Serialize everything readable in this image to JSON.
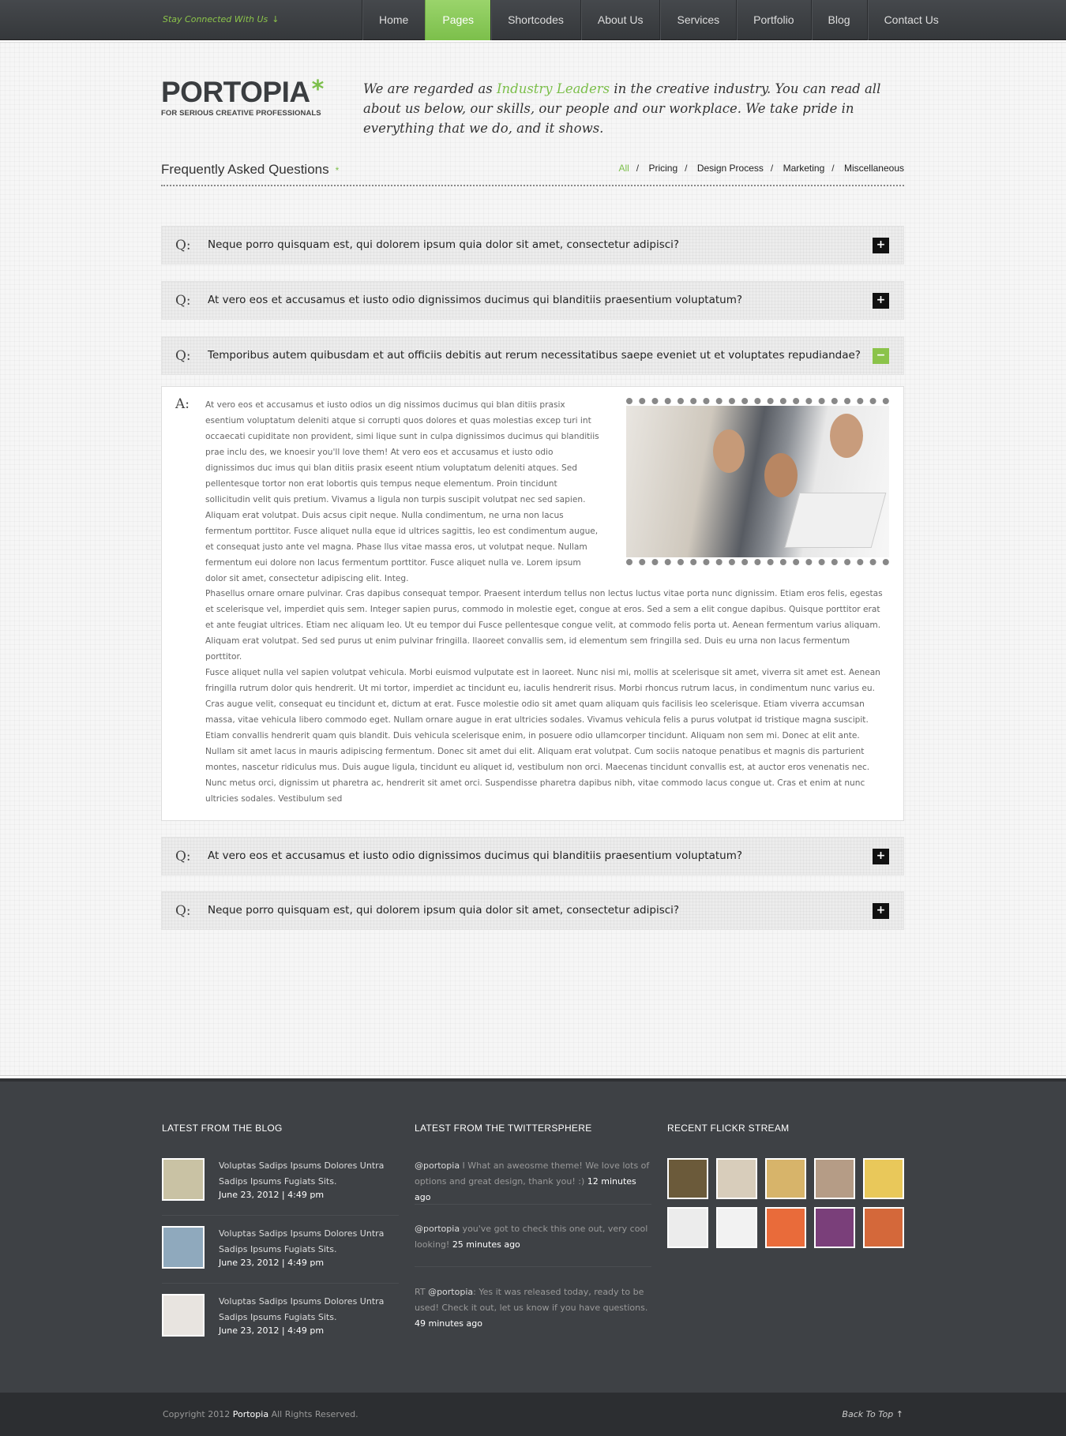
{
  "topbar": {
    "stay_connected": "Stay Connected With Us",
    "stay_icon": "arrow-down-icon",
    "nav": [
      "Home",
      "Pages",
      "Shortcodes",
      "About Us",
      "Services",
      "Portfolio",
      "Blog",
      "Contact Us"
    ],
    "active_nav": "Pages"
  },
  "header": {
    "logo": "PORTOPIA",
    "logo_star": "*",
    "tagline": "FOR SERIOUS CREATIVE PROFESSIONALS",
    "intro_before": "We are regarded as ",
    "intro_highlight": "Industry Leaders",
    "intro_after": " in the creative industry. You can read all about us below, our skills, our people and our workplace. We take pride in everything that we do, and it shows."
  },
  "faq": {
    "title": "Frequently Asked Questions",
    "title_star": "*",
    "filters": [
      "All",
      "Pricing",
      "Design Process",
      "Marketing",
      "Miscellaneous"
    ],
    "active_filter": "All",
    "q_label": "Q:",
    "a_label": "A:",
    "questions": [
      {
        "text": "Neque porro quisquam est, qui dolorem ipsum quia dolor sit amet, consectetur adipisci?",
        "toggle": "+"
      },
      {
        "text": "At vero eos et accusamus et iusto odio dignissimos ducimus qui blanditiis praesentium voluptatum?",
        "toggle": "+"
      },
      {
        "text": "Temporibus autem quibusdam et aut officiis debitis aut rerum necessitatibus saepe eveniet ut et voluptates repudiandae?",
        "toggle": "−"
      },
      {
        "text": "At vero eos et accusamus et iusto odio dignissimos ducimus qui blanditiis praesentium voluptatum?",
        "toggle": "+"
      },
      {
        "text": "Neque porro quisquam est, qui dolorem ipsum quia dolor sit amet, consectetur adipisci?",
        "toggle": "+"
      }
    ],
    "answer_p1": "At vero eos et accusamus et iusto odios un  dig nissimos ducimus qui blan ditiis prasix esentium voluptatum deleniti atque si corrupti quos dolores et quas molestias excep turi int occaecati cupiditate non provident, simi lique sunt in culpa dignissimos ducimus qui blanditiis prae inclu des, we knoesir you'll love them! At vero eos et accusamus et iusto odio dignissimos duc imus qui blan ditiis prasix eseent ntium voluptatum deleniti atques. Sed pellentesque tortor non erat lobortis quis tempus neque elementum. Proin tincidunt sollicitudin velit quis pretium. Vivamus a ligula non turpis suscipit volutpat nec sed sapien. Aliquam erat volutpat. Duis acsus cipit neque. Nulla condimentum, ne urna non lacus fermentum porttitor. Fusce aliquet nulla eque id ultrices sagittis, leo est condimentum augue, et consequat justo ante vel magna. Phase llus vitae massa eros, ut volutpat neque. Nullam fermentum eui dolore non lacus fermentum porttitor. Fusce aliquet nulla ve. Lorem ipsum dolor sit amet, consectetur adipiscing elit. Integ.",
    "answer_p2": "Phasellus ornare ornare pulvinar. Cras dapibus consequat tempor. Praesent interdum tellus non lectus luctus vitae porta nunc dignissim. Etiam eros felis, egestas et scelerisque vel, imperdiet quis sem. Integer sapien purus, commodo in molestie eget, congue at eros. Sed a sem a elit congue dapibus. Quisque porttitor erat et ante feugiat ultrices. Etiam nec aliquam leo. Ut eu tempor dui Fusce pellentesque congue velit, at commodo felis porta ut. Aenean fermentum varius aliquam. Aliquam erat volutpat. Sed sed purus ut enim pulvinar fringilla. Ilaoreet convallis sem, id elementum sem fringilla sed. Duis eu urna non lacus fermentum porttitor.",
    "answer_p3": " Fusce aliquet nulla vel sapien volutpat vehicula. Morbi euismod vulputate est in laoreet. Nunc nisi mi, mollis at scelerisque sit amet, viverra sit amet est. Aenean fringilla rutrum dolor quis hendrerit. Ut mi tortor, imperdiet ac tincidunt eu, iaculis hendrerit risus. Morbi rhoncus rutrum lacus, in condimentum nunc varius eu. Cras augue velit, consequat eu tincidunt et, dictum at erat. Fusce molestie odio sit amet quam aliquam quis facilisis leo scelerisque. Etiam viverra accumsan massa, vitae vehicula libero commodo eget. Nullam ornare augue in erat ultricies sodales. Vivamus vehicula felis a purus volutpat id tristique magna suscipit. Etiam convallis hendrerit quam quis blandit. Duis vehicula scelerisque enim, in posuere odio ullamcorper tincidunt. Aliquam non sem mi. Donec at elit ante. Nullam sit amet lacus in mauris adipiscing fermentum. Donec sit amet dui elit. Aliquam erat volutpat. Cum sociis natoque penatibus et magnis dis parturient montes, nascetur ridiculus mus. Duis augue ligula, tincidunt eu aliquet id, vestibulum non orci. Maecenas tincidunt convallis est, at auctor eros venenatis nec. Nunc metus orci, dignissim ut pharetra ac, hendrerit sit amet orci. Suspendisse pharetra dapibus nibh, vitae commodo lacus congue ut. Cras et enim at nunc ultricies sodales. Vestibulum sed"
  },
  "footer": {
    "blog_title": "LATEST FROM THE BLOG",
    "blog": [
      {
        "title": "Voluptas Sadips Ipsums Dolores Untra Sadips Ipsums Fugiats Sits.",
        "date": "June 23, 2012   |   4:49 pm",
        "thumb_color": "#c9c2a4"
      },
      {
        "title": "Voluptas Sadips Ipsums Dolores Untra Sadips Ipsums Fugiats Sits.",
        "date": "June 23, 2012   |   4:49 pm",
        "thumb_color": "#8fa9bd"
      },
      {
        "title": "Voluptas Sadips Ipsums Dolores Untra Sadips Ipsums Fugiats Sits.",
        "date": "June 23, 2012   |   4:49 pm",
        "thumb_color": "#e8e4e0"
      }
    ],
    "twitter_title": "LATEST FROM THE TWITTERSPHERE",
    "tweets": [
      {
        "pre": "",
        "user": "@portopia",
        "text": " I What an aweosme theme!  We love lots of options and great design, thank you!  :) ",
        "time": "12 minutes ago"
      },
      {
        "pre": "",
        "user": "@portopia",
        "text": " you've got to check this one out, very cool looking! ",
        "time": "25 minutes ago"
      },
      {
        "pre": "RT ",
        "user": "@portopia",
        "text": ": Yes it was released today, ready to be used! Check it out, let us know if you have questions.",
        "time": "49 minutes ago"
      }
    ],
    "flickr_title": "RECENT FLICKR STREAM",
    "flickr_colors": [
      "#6b5a3a",
      "#d8cdbb",
      "#d7b46a",
      "#b59c86",
      "#e9c85a",
      "#ececec",
      "#f2f2f2",
      "#e96b3a",
      "#7a3f7a",
      "#d4683a"
    ],
    "copyright_pre": "Copyright 2012 ",
    "copyright_brand": "Portopia",
    "copyright_post": "  All Rights Reserved.",
    "back_to_top": "Back To Top",
    "back_icon": "arrow-up-icon"
  }
}
